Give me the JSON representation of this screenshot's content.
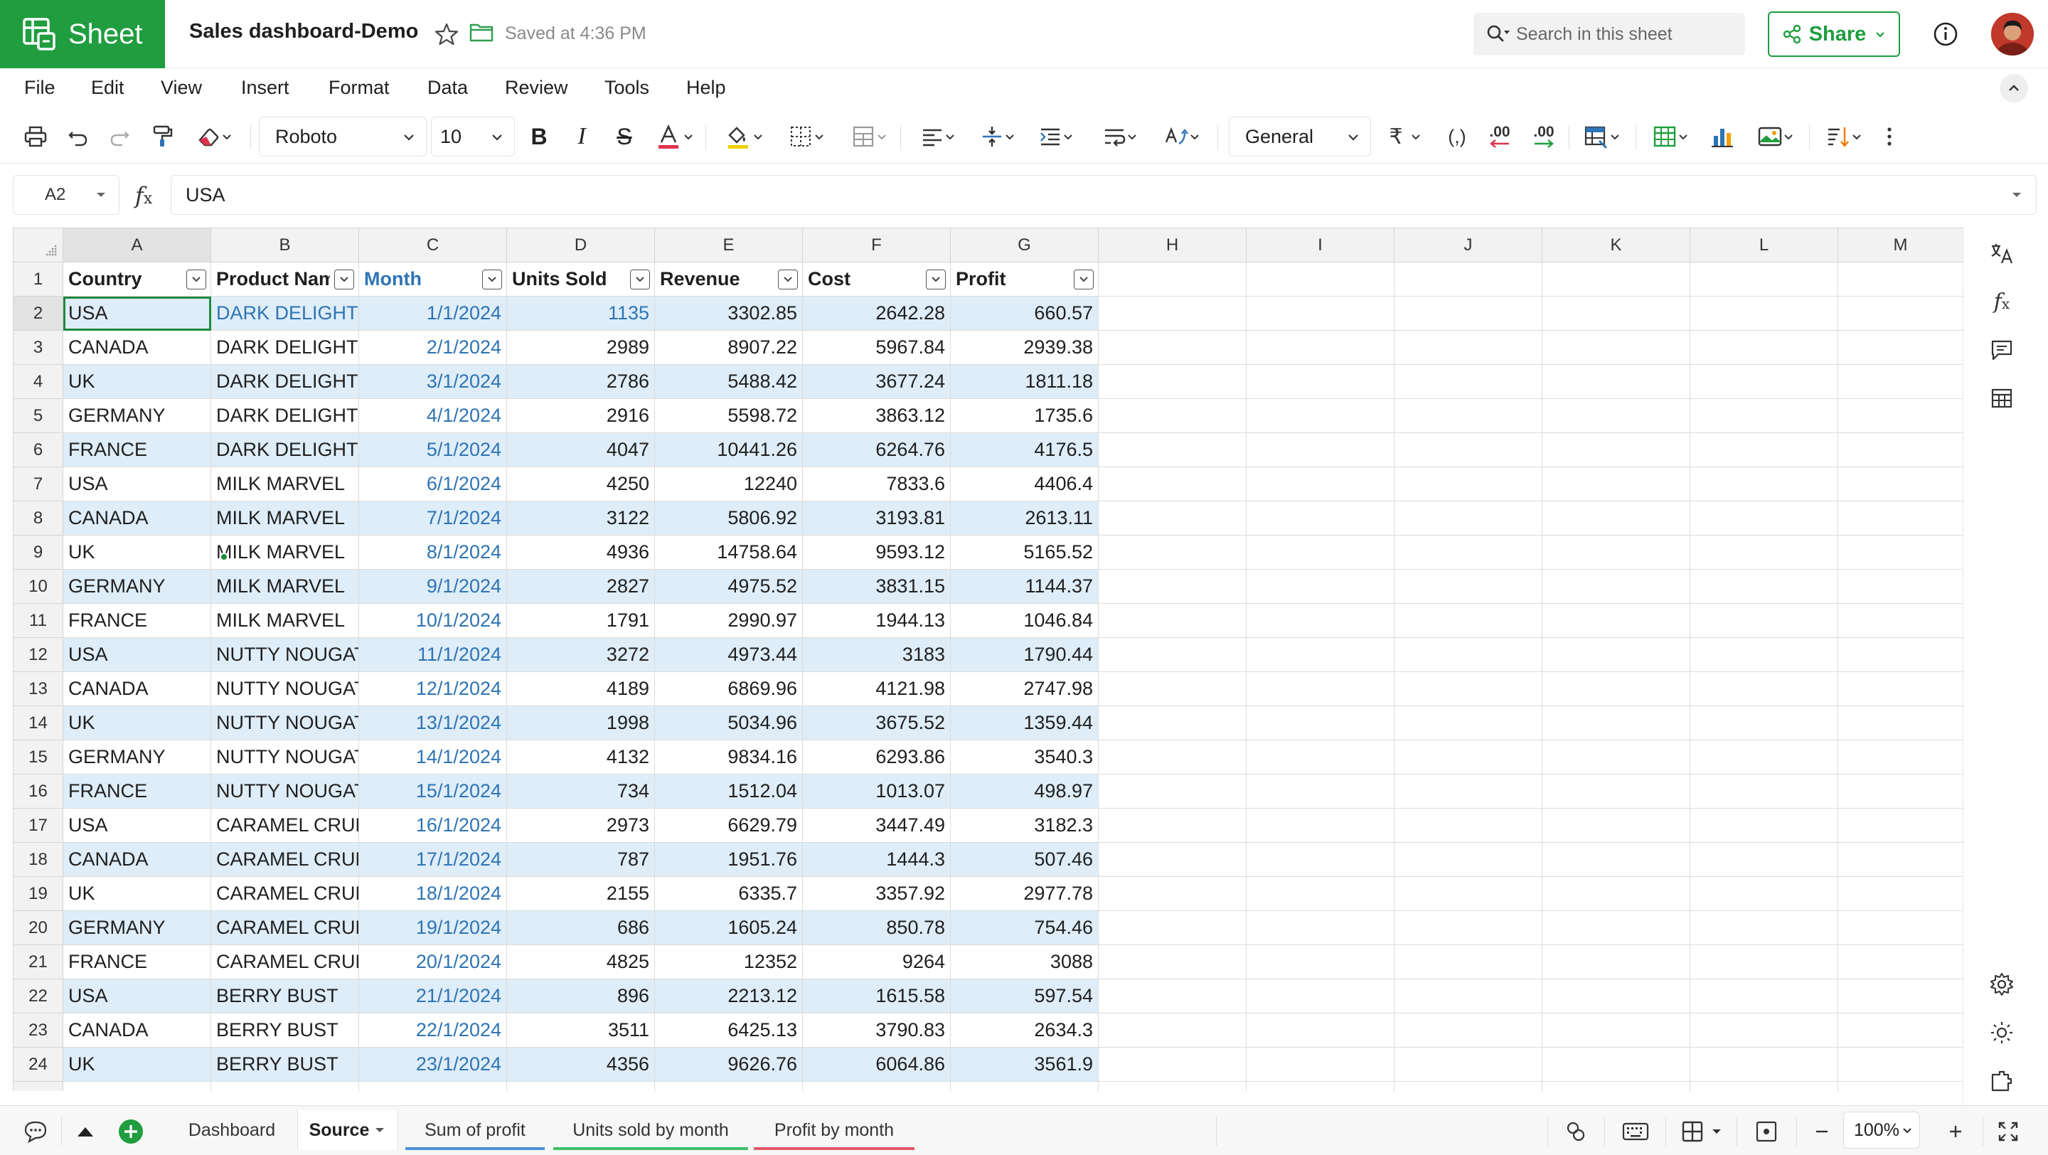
{
  "app": {
    "brand": "Sheet",
    "doc_title": "Sales dashboard-Demo",
    "save_status": "Saved at 4:36 PM"
  },
  "header": {
    "search_placeholder": "Search in this sheet",
    "share_label": "Share"
  },
  "menu": [
    "File",
    "Edit",
    "View",
    "Insert",
    "Format",
    "Data",
    "Review",
    "Tools",
    "Help"
  ],
  "toolbar": {
    "font": "Roboto",
    "size": "10",
    "number_format": "General",
    "currency_symbol": "₹",
    "decimal_dec": ".00",
    "decimal_inc": ".00",
    "comma": "(,)"
  },
  "formula_bar": {
    "cell_ref": "A2",
    "value": "USA"
  },
  "columns": [
    "A",
    "B",
    "C",
    "D",
    "E",
    "F",
    "G",
    "H",
    "I",
    "J",
    "K",
    "L",
    "M"
  ],
  "table": {
    "headers": [
      "Country",
      "Product Name",
      "Month",
      "Units Sold",
      "Revenue",
      "Cost",
      "Profit"
    ],
    "rows": [
      [
        "USA",
        "DARK DELIGHT",
        "1/1/2024",
        "1135",
        "3302.85",
        "2642.28",
        "660.57"
      ],
      [
        "CANADA",
        "DARK DELIGHT",
        "2/1/2024",
        "2989",
        "8907.22",
        "5967.84",
        "2939.38"
      ],
      [
        "UK",
        "DARK DELIGHT",
        "3/1/2024",
        "2786",
        "5488.42",
        "3677.24",
        "1811.18"
      ],
      [
        "GERMANY",
        "DARK DELIGHT",
        "4/1/2024",
        "2916",
        "5598.72",
        "3863.12",
        "1735.6"
      ],
      [
        "FRANCE",
        "DARK DELIGHT",
        "5/1/2024",
        "4047",
        "10441.26",
        "6264.76",
        "4176.5"
      ],
      [
        "USA",
        "MILK MARVEL",
        "6/1/2024",
        "4250",
        "12240",
        "7833.6",
        "4406.4"
      ],
      [
        "CANADA",
        "MILK MARVEL",
        "7/1/2024",
        "3122",
        "5806.92",
        "3193.81",
        "2613.11"
      ],
      [
        "UK",
        "MILK MARVEL",
        "8/1/2024",
        "4936",
        "14758.64",
        "9593.12",
        "5165.52"
      ],
      [
        "GERMANY",
        "MILK MARVEL",
        "9/1/2024",
        "2827",
        "4975.52",
        "3831.15",
        "1144.37"
      ],
      [
        "FRANCE",
        "MILK MARVEL",
        "10/1/2024",
        "1791",
        "2990.97",
        "1944.13",
        "1046.84"
      ],
      [
        "USA",
        "NUTTY NOUGAT",
        "11/1/2024",
        "3272",
        "4973.44",
        "3183",
        "1790.44"
      ],
      [
        "CANADA",
        "NUTTY NOUGAT",
        "12/1/2024",
        "4189",
        "6869.96",
        "4121.98",
        "2747.98"
      ],
      [
        "UK",
        "NUTTY NOUGAT",
        "13/1/2024",
        "1998",
        "5034.96",
        "3675.52",
        "1359.44"
      ],
      [
        "GERMANY",
        "NUTTY NOUGAT",
        "14/1/2024",
        "4132",
        "9834.16",
        "6293.86",
        "3540.3"
      ],
      [
        "FRANCE",
        "NUTTY NOUGAT",
        "15/1/2024",
        "734",
        "1512.04",
        "1013.07",
        "498.97"
      ],
      [
        "USA",
        "CARAMEL CRUNCH",
        "16/1/2024",
        "2973",
        "6629.79",
        "3447.49",
        "3182.3"
      ],
      [
        "CANADA",
        "CARAMEL CRUNCH",
        "17/1/2024",
        "787",
        "1951.76",
        "1444.3",
        "507.46"
      ],
      [
        "UK",
        "CARAMEL CRUNCH",
        "18/1/2024",
        "2155",
        "6335.7",
        "3357.92",
        "2977.78"
      ],
      [
        "GERMANY",
        "CARAMEL CRUNCH",
        "19/1/2024",
        "686",
        "1605.24",
        "850.78",
        "754.46"
      ],
      [
        "FRANCE",
        "CARAMEL CRUNCH",
        "20/1/2024",
        "4825",
        "12352",
        "9264",
        "3088"
      ],
      [
        "USA",
        "BERRY BUST",
        "21/1/2024",
        "896",
        "2213.12",
        "1615.58",
        "597.54"
      ],
      [
        "CANADA",
        "BERRY BUST",
        "22/1/2024",
        "3511",
        "6425.13",
        "3790.83",
        "2634.3"
      ],
      [
        "UK",
        "BERRY BUST",
        "23/1/2024",
        "4356",
        "9626.76",
        "6064.86",
        "3561.9"
      ]
    ]
  },
  "sheet_tabs": [
    {
      "label": "Dashboard",
      "active": false,
      "color": ""
    },
    {
      "label": "Source",
      "active": true,
      "color": ""
    },
    {
      "label": "Sum of profit",
      "active": false,
      "color": "#4a90d9"
    },
    {
      "label": "Units sold by month",
      "active": false,
      "color": "#3fbf6a"
    },
    {
      "label": "Profit by month",
      "active": false,
      "color": "#e05a6b"
    }
  ],
  "zoom": {
    "value": "100%"
  },
  "colors": {
    "brand": "#1f9d3f",
    "band": "#deedf8",
    "date_blue": "#2e74b5",
    "selection": "#1f8a3e"
  }
}
